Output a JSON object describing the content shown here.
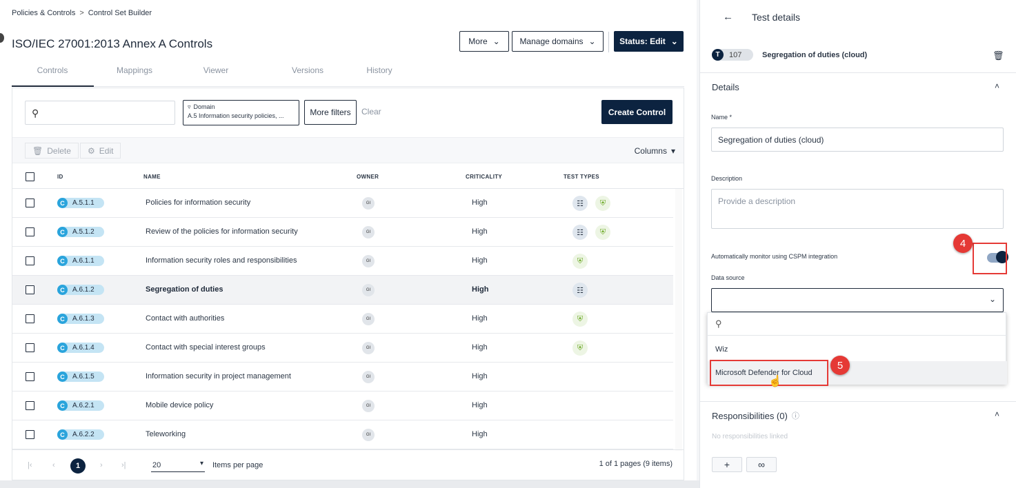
{
  "breadcrumb": {
    "parent": "Policies & Controls",
    "separator": ">",
    "current": "Control Set Builder"
  },
  "page": {
    "title": "ISO/IEC 27001:2013 Annex A Controls"
  },
  "header_buttons": {
    "more": "More",
    "manage_domains": "Manage domains",
    "status": "Status: Edit"
  },
  "tabs": [
    {
      "label": "Controls",
      "active": true
    },
    {
      "label": "Mappings"
    },
    {
      "label": "Viewer"
    },
    {
      "label": "Versions"
    },
    {
      "label": "History"
    }
  ],
  "filters": {
    "search_placeholder": "",
    "domain_chip_label": "Domain",
    "domain_chip_value": "A.5 Information security policies, ...",
    "more_filters": "More filters",
    "clear": "Clear",
    "create": "Create Control"
  },
  "toolbar": {
    "delete": "Delete",
    "edit": "Edit",
    "columns": "Columns"
  },
  "table": {
    "headers": {
      "id": "ID",
      "name": "NAME",
      "owner": "OWNER",
      "criticality": "CRITICALITY",
      "test_types": "TEST TYPES"
    },
    "rows": [
      {
        "badge": "C",
        "id": "A.5.1.1",
        "name": "Policies for information security",
        "owner": "GI",
        "criticality": "High",
        "tests": [
          "doc",
          "shield"
        ]
      },
      {
        "badge": "C",
        "id": "A.5.1.2",
        "name": "Review of the policies for information security",
        "owner": "GI",
        "criticality": "High",
        "tests": [
          "doc",
          "shield"
        ]
      },
      {
        "badge": "C",
        "id": "A.6.1.1",
        "name": "Information security roles and responsibilities",
        "owner": "GI",
        "criticality": "High",
        "tests": [
          "shield"
        ]
      },
      {
        "badge": "C",
        "id": "A.6.1.2",
        "name": "Segregation of duties",
        "owner": "GI",
        "criticality": "High",
        "tests": [
          "doc"
        ],
        "selected": true
      },
      {
        "badge": "C",
        "id": "A.6.1.3",
        "name": "Contact with authorities",
        "owner": "GI",
        "criticality": "High",
        "tests": [
          "shield"
        ]
      },
      {
        "badge": "C",
        "id": "A.6.1.4",
        "name": "Contact with special interest groups",
        "owner": "GI",
        "criticality": "High",
        "tests": [
          "shield"
        ]
      },
      {
        "badge": "C",
        "id": "A.6.1.5",
        "name": "Information security in project management",
        "owner": "GI",
        "criticality": "High",
        "tests": []
      },
      {
        "badge": "C",
        "id": "A.6.2.1",
        "name": "Mobile device policy",
        "owner": "GI",
        "criticality": "High",
        "tests": []
      },
      {
        "badge": "C",
        "id": "A.6.2.2",
        "name": "Teleworking",
        "owner": "GI",
        "criticality": "High",
        "tests": []
      }
    ]
  },
  "pager": {
    "current_page": "1",
    "per_page": "20",
    "per_page_label": "Items per page",
    "info": "1 of 1 pages (9 items)"
  },
  "details_panel": {
    "title": "Test details",
    "test_badge": "T",
    "test_number": "107",
    "test_name": "Segregation of duties (cloud)",
    "section_details": "Details",
    "name_label": "Name *",
    "name_value": "Segregation of duties (cloud)",
    "description_label": "Description",
    "description_placeholder": "Provide a description",
    "monitor_label": "Automatically monitor using CSPM integration",
    "monitor_enabled": true,
    "data_source_label": "Data source",
    "data_source_value": "",
    "data_source_options": [
      "Wiz",
      "Microsoft Defender for Cloud"
    ],
    "responsibilities_title": "Responsibilities (0)",
    "responsibilities_empty": "No responsibilities linked",
    "add_button": "+"
  },
  "annotations": {
    "step4": "4",
    "step5": "5"
  },
  "colors": {
    "navy": "#0c2340",
    "pill_blue": "#2aa4dc",
    "highlight_red": "#e53935",
    "shield_green": "#6aa823"
  }
}
